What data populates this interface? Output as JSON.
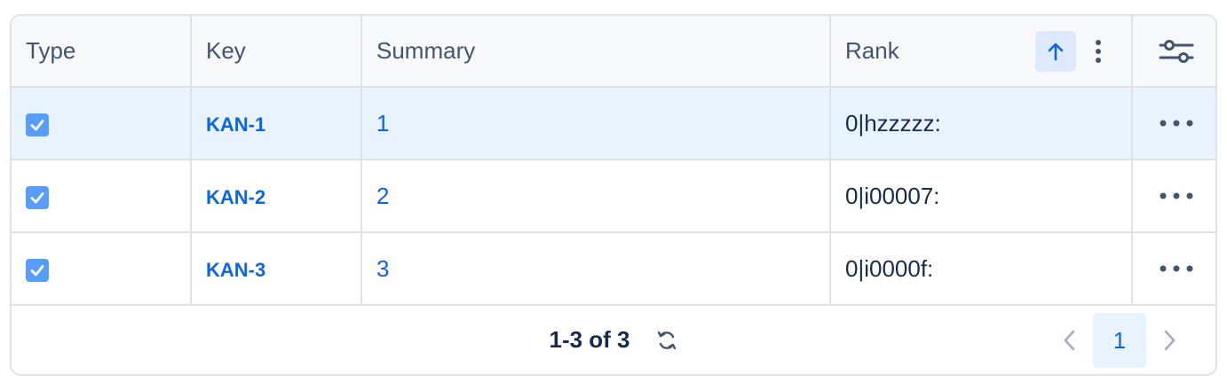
{
  "columns": {
    "type": "Type",
    "key": "Key",
    "summary": "Summary",
    "rank": "Rank"
  },
  "rows": [
    {
      "checked": true,
      "key": "KAN-1",
      "summary": "1",
      "rank": "0|hzzzzz:",
      "selected": true
    },
    {
      "checked": true,
      "key": "KAN-2",
      "summary": "2",
      "rank": "0|i00007:",
      "selected": false
    },
    {
      "checked": true,
      "key": "KAN-3",
      "summary": "3",
      "rank": "0|i0000f:",
      "selected": false
    }
  ],
  "footer": {
    "count": "1-3 of 3",
    "current_page": "1"
  },
  "icons": {
    "sort": "arrow-up-icon",
    "column_menu": "vertical-ellipsis-icon",
    "settings": "sliders-icon",
    "row_more": "horizontal-ellipsis-icon",
    "refresh": "refresh-icon",
    "prev": "chevron-left-icon",
    "next": "chevron-right-icon",
    "checkbox": "check-icon"
  },
  "colors": {
    "link": "#0c66e4",
    "selected_row": "#e9f2ff",
    "checkbox": "#579dff",
    "border": "#dfe1e6"
  }
}
